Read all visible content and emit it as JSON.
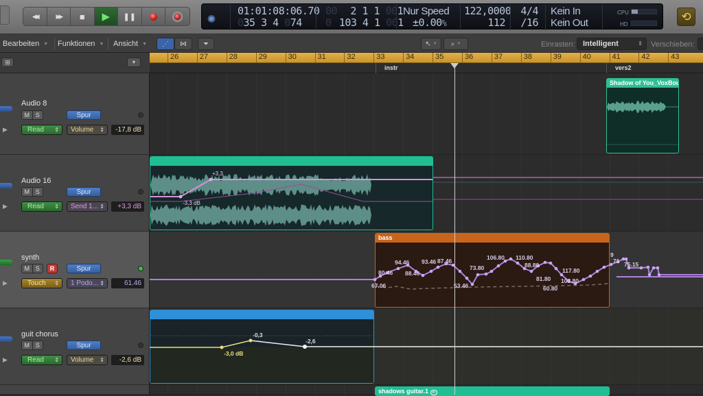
{
  "control_bar": {
    "transport": [
      {
        "name": "rewind",
        "glyph": "◀◀"
      },
      {
        "name": "forward",
        "glyph": "▶▶"
      },
      {
        "name": "stop",
        "glyph": "■"
      },
      {
        "name": "play",
        "glyph": "▶"
      },
      {
        "name": "pause",
        "glyph": "❚❚"
      },
      {
        "name": "record",
        "glyph": ""
      },
      {
        "name": "capture-record",
        "glyph": ""
      }
    ],
    "lcd": {
      "smpte": "01:01:08:06.70",
      "bars_beats_top": "2  1  1",
      "bars_beats_top_prefix": "00",
      "bars_beats_top_ticks": "1",
      "bars_beats_top_ticks_prefix": "00",
      "bars_beats_bottom_prefix": "0",
      "bars_beats_bottom": "35  3  4",
      "bars_beats_bottom_ticks_prefix": "0",
      "bars_beats_bottom_ticks": "74",
      "locator_prefix": "0",
      "locator": "103  4  1",
      "locator_ticks_prefix": "00",
      "locator_ticks": "1",
      "varispeed_mode": "Nur Speed",
      "varispeed_value": "±0.00",
      "varispeed_unit": "%",
      "tempo": "122,0000",
      "tempo_bottom": "112",
      "signature": "4/4",
      "division": "/16",
      "midi_in": "Kein In",
      "midi_out": "Kein Out",
      "cpu_label": "CPU",
      "hd_label": "HD",
      "cpu_load": 0.05,
      "hd_load": 0.0
    },
    "cycle_glyph": "⟲"
  },
  "toolbar": {
    "menus": [
      "Bearbeiten",
      "Funktionen",
      "Ansicht"
    ],
    "snap_label": "Einrasten:",
    "snap_value": "Intelligent",
    "drag_label": "Verschieben:",
    "pointer_tool": "↖",
    "zoom_tool": "⌕"
  },
  "ruler": {
    "bars": [
      "26",
      "27",
      "28",
      "29",
      "30",
      "31",
      "32",
      "33",
      "34",
      "35",
      "36",
      "37",
      "38",
      "39",
      "40",
      "41",
      "42",
      "43"
    ],
    "markers": [
      {
        "label": "instr"
      },
      {
        "label": "vers2"
      }
    ]
  },
  "tracks": [
    {
      "name": "Audio 8",
      "mute": "M",
      "solo": "S",
      "spur": "Spur",
      "automation_mode": "Read",
      "parameter": "Volume",
      "value": "-17,8 dB"
    },
    {
      "name": "Audio 16",
      "mute": "M",
      "solo": "S",
      "spur": "Spur",
      "automation_mode": "Read",
      "parameter": "Send 1...",
      "value": "+3,3 dB"
    },
    {
      "name": "synth",
      "mute": "M",
      "solo": "S",
      "record": "R",
      "spur": "Spur",
      "automation_mode": "Touch",
      "parameter": "1 Podo...",
      "value": "61.46"
    },
    {
      "name": "guit chorus",
      "mute": "M",
      "solo": "S",
      "spur": "Spur",
      "automation_mode": "Read",
      "parameter": "Volume",
      "value": "-2,6 dB"
    }
  ],
  "regions": {
    "shadow": {
      "name": "Shadow of You_VoxBou",
      "color": "#2fbf93"
    },
    "audio16": {
      "color": "#1fbf93"
    },
    "bass": {
      "name": "bass",
      "color": "#c8651a"
    },
    "guit": {
      "color": "#2f8fd8"
    },
    "shadows_guitar": {
      "name": "shadows guitar.1",
      "color": "#1fbf93"
    }
  },
  "automation": {
    "audio16_labels": [
      "+3,3",
      "-3,3 dB"
    ],
    "bass_labels": [
      "67.06",
      "80.46",
      "94.46",
      "88.46",
      "93.46",
      "87.46",
      "53.46",
      "73.80",
      "106.80",
      "110.80",
      "88.80",
      "81.80",
      "60.80",
      "103.80",
      "117.80",
      "9",
      "71",
      "75.15"
    ],
    "guit_labels": [
      "-3,0 dB",
      "-0,3",
      "-2,6"
    ]
  }
}
